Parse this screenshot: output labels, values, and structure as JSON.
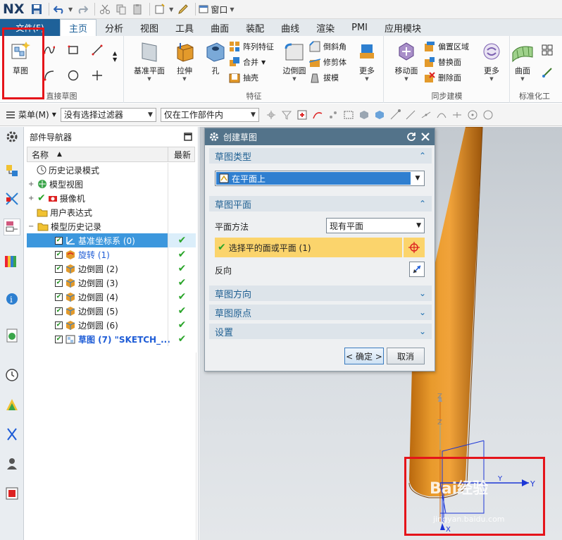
{
  "app": {
    "logo": "NX"
  },
  "titlebar": {
    "window_menu": "窗口"
  },
  "ribbon": {
    "file_tab": "文件(F)",
    "tabs": [
      "主页",
      "分析",
      "视图",
      "工具",
      "曲面",
      "装配",
      "曲线",
      "渲染",
      "PMI",
      "应用模块"
    ],
    "active_tab": "主页",
    "groups": {
      "direct_sketch": {
        "label": "直接草图",
        "sketch_button": "草图"
      },
      "feature": {
        "label": "特征",
        "datum_plane": "基准平面",
        "extrude": "拉伸",
        "hole": "孔",
        "pattern_feature": "阵列特征",
        "unite": "合并",
        "shell": "抽壳",
        "edge_blend": "边倒圆",
        "chamfer": "倒斜角",
        "trim_body": "修剪体",
        "draft": "拔模",
        "more": "更多"
      },
      "sync_modeling": {
        "label": "同步建模",
        "move_face": "移动面",
        "offset_region": "偏置区域",
        "replace_face": "替换面",
        "delete_face": "删除面",
        "more": "更多"
      },
      "surface": {
        "label": "标准化工",
        "surface": "曲面"
      }
    }
  },
  "cmdbar": {
    "menu": "菜单(M)",
    "filter": "没有选择过滤器",
    "scope": "仅在工作部件内"
  },
  "navigator": {
    "title": "部件导航器",
    "col_name": "名称",
    "col_latest": "最新",
    "rows": [
      {
        "label": "历史记录模式",
        "latest": ""
      },
      {
        "label": "模型视图",
        "latest": ""
      },
      {
        "label": "摄像机",
        "latest": ""
      },
      {
        "label": "用户表达式",
        "latest": ""
      },
      {
        "label": "模型历史记录",
        "latest": ""
      },
      {
        "label": "基准坐标系 (0)",
        "latest": "✔"
      },
      {
        "label": "旋转 (1)",
        "latest": "✔"
      },
      {
        "label": "边倒圆 (2)",
        "latest": "✔"
      },
      {
        "label": "边倒圆 (3)",
        "latest": "✔"
      },
      {
        "label": "边倒圆 (4)",
        "latest": "✔"
      },
      {
        "label": "边倒圆 (5)",
        "latest": "✔"
      },
      {
        "label": "边倒圆 (6)",
        "latest": "✔"
      },
      {
        "label": "草图 (7) \"SKETCH_...",
        "latest": "✔"
      }
    ]
  },
  "dialog": {
    "title": "创建草图",
    "sketch_type_header": "草图类型",
    "sketch_type_value": "在平面上",
    "sketch_plane_header": "草图平面",
    "plane_method_label": "平面方法",
    "plane_method_value": "现有平面",
    "select_face": "选择平的面或平面 (1)",
    "reverse_label": "反向",
    "sketch_orientation_header": "草图方向",
    "sketch_origin_header": "草图原点",
    "settings_header": "设置",
    "ok": "< 确定 >",
    "cancel": "取消"
  },
  "graphics": {
    "axis_labels": {
      "x": "X",
      "y": "Y",
      "z": "Z"
    },
    "watermark": "Bai经验",
    "watermark_url": "jingyan.baidu.com"
  },
  "colors": {
    "accent": "#1e6199",
    "selection": "#3c97dd",
    "highlight": "#fbd46c",
    "part": "#d88a1c",
    "annotation": "#e5141a"
  }
}
